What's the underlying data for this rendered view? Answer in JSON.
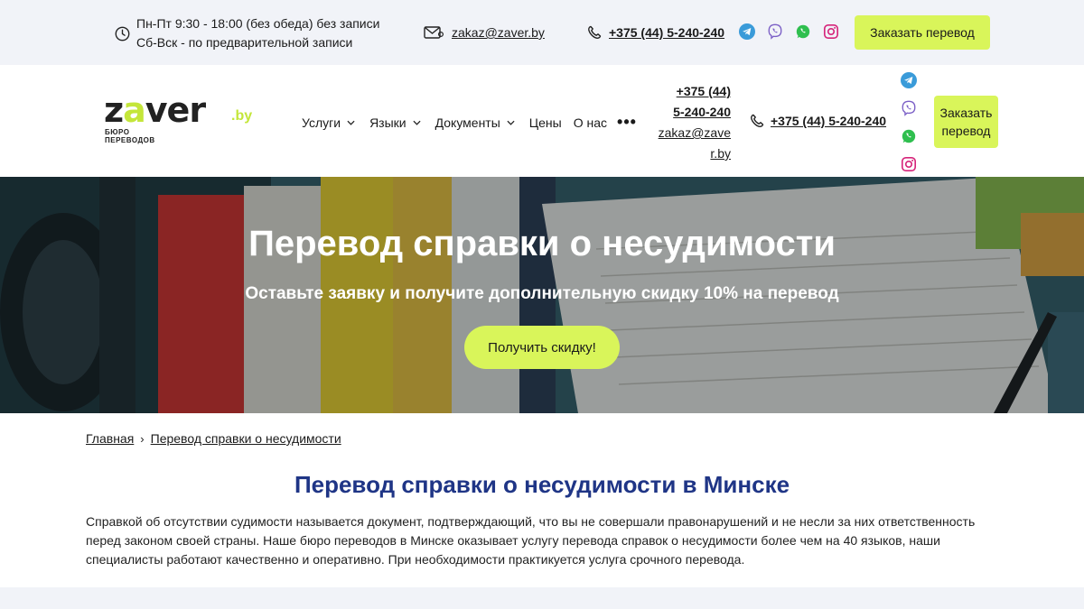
{
  "topbar": {
    "hours_line1": "Пн-Пт 9:30 - 18:00 (без обеда) без записи",
    "hours_line2": "Сб-Вск - по предварительной записи",
    "email": "zakaz@zaver.by",
    "phone": "+375 (44) 5-240-240",
    "socials": [
      "telegram-icon",
      "viber-icon",
      "whatsapp-icon",
      "instagram-icon"
    ],
    "order_button": "Заказать перевод"
  },
  "header": {
    "logo": {
      "word_start": "z",
      "word_accent": "a",
      "word_end": "ver",
      "tld": ".by",
      "sub_line1": "БЮРО",
      "sub_line2": "ПЕРЕВОДОВ"
    },
    "nav": [
      {
        "label": "Услуги",
        "dropdown": true
      },
      {
        "label": "Языки",
        "dropdown": true
      },
      {
        "label": "Документы",
        "dropdown": true
      },
      {
        "label": "Цены",
        "dropdown": false
      },
      {
        "label": "О нас",
        "dropdown": false
      }
    ],
    "more_label": "•••",
    "contact_phone_line1": "+375 (44)",
    "contact_phone_line2": "5-240-240",
    "contact_email_line1": "zakaz@zave",
    "contact_email_line2": "r.by",
    "phone": "+375 (44) 5-240-240",
    "order_line1": "Заказать",
    "order_line2": "перевод"
  },
  "hero": {
    "title": "Перевод справки о несудимости",
    "subtitle": "Оставьте заявку и получите дополнительную скидку 10% на перевод",
    "cta": "Получить скидку!"
  },
  "breadcrumb": {
    "home": "Главная",
    "separator": "›",
    "current": "Перевод справки о несудимости"
  },
  "content": {
    "title": "Перевод справки о несудимости в Минске",
    "intro": "Справкой об отсутствии судимости называется документ, подтверждающий, что вы не совершали правонарушений и не несли за них ответственность перед законом своей страны. Наше бюро переводов в Минске оказывает услугу перевода справок о несудимости более чем на 40 языков, наши специалисты работают качественно и оперативно. При необходимости практикуется услуга срочного перевода."
  },
  "colors": {
    "accent": "#d9f55a",
    "title_blue": "#1f3586",
    "topbar_bg": "#f1f3f8",
    "telegram": "#3a9bd9",
    "viber": "#7b5fc6",
    "whatsapp": "#2fbf4f",
    "instagram": "#d6247a"
  }
}
